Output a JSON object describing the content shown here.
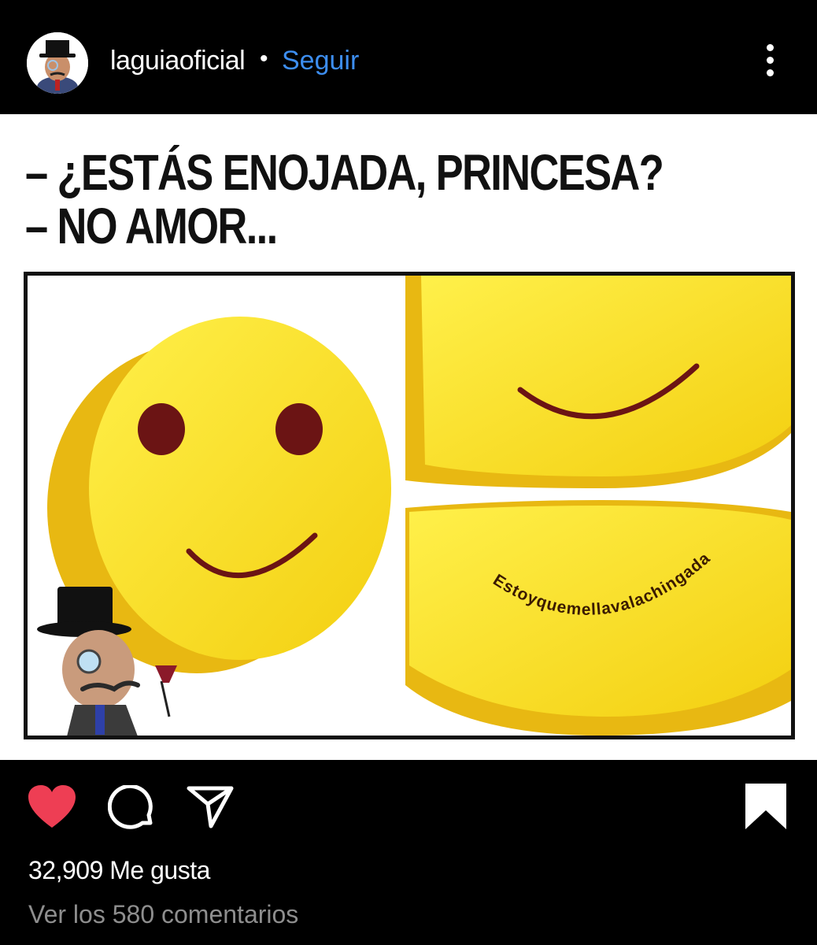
{
  "header": {
    "username": "laguiaoficial",
    "separator": "•",
    "follow_label": "Seguir"
  },
  "post": {
    "caption_line1": "– ¿ESTÁS ENOJADA, PRINCESA?",
    "caption_line2": "– NO AMOR...",
    "hidden_text": "Estoyquemellavalachingada"
  },
  "actions": {
    "likes": "32,909 Me gusta",
    "comments_link": "Ver los 580 comentarios"
  },
  "colors": {
    "like_heart": "#ee3e54",
    "follow_link": "#3d8ef0",
    "smiley_yellow": "#f9df1c"
  },
  "icons": [
    "more-options-icon",
    "heart-icon",
    "comment-icon",
    "share-icon",
    "bookmark-icon"
  ]
}
